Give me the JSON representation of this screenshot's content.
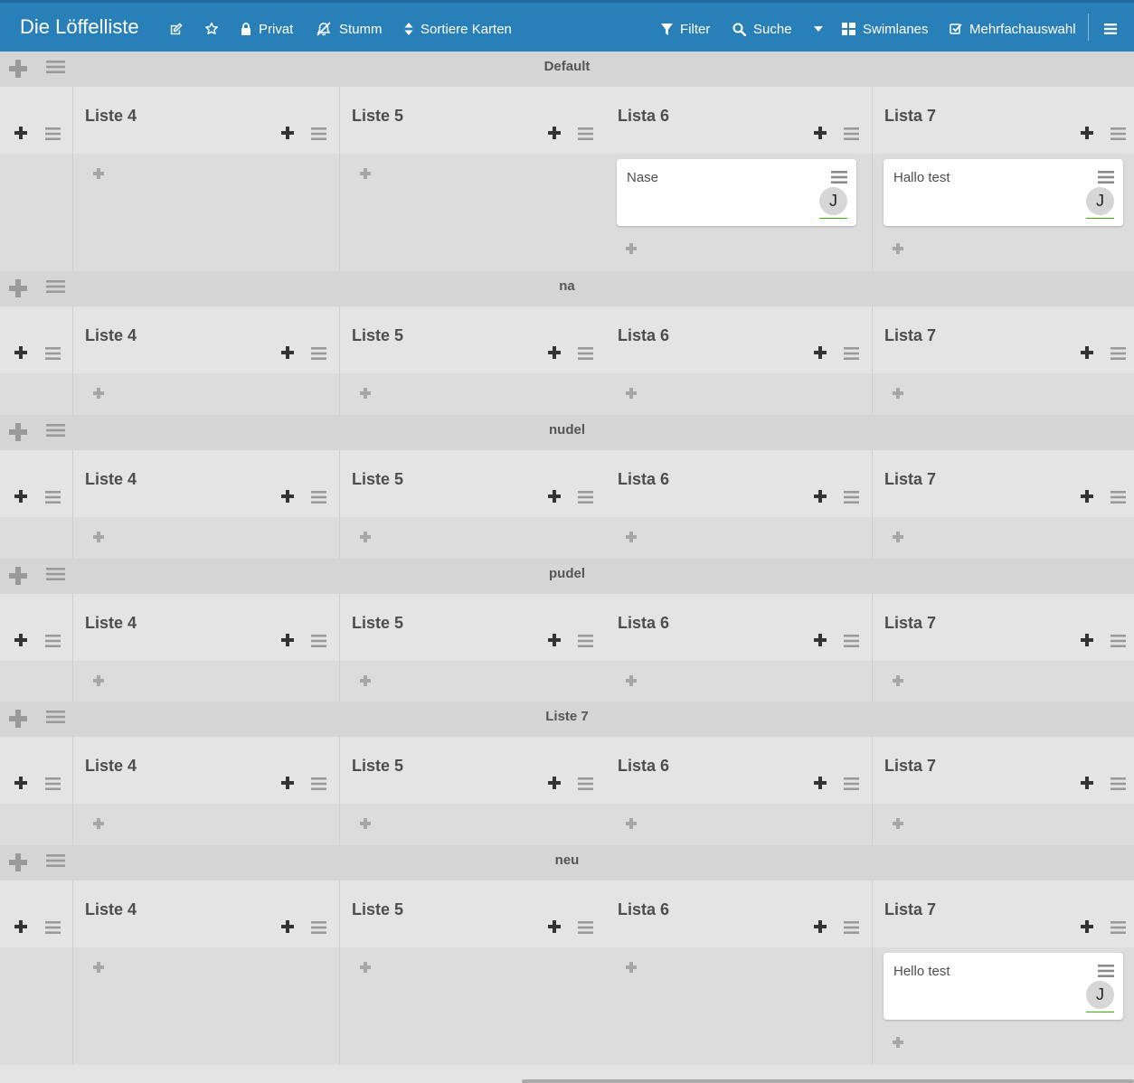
{
  "header": {
    "board_title": "Die Löffelliste",
    "private_label": "Privat",
    "mute_label": "Stumm",
    "sort_label": "Sortiere Karten",
    "filter_label": "Filter",
    "search_label": "Suche",
    "swimlanes_label": "Swimlanes",
    "multiselect_label": "Mehrfachauswahl"
  },
  "lists": [
    "Liste 4",
    "Liste 5",
    "Lista 6",
    "Lista 7"
  ],
  "swimlanes": [
    {
      "title": "Default",
      "cards": [
        {
          "list": 2,
          "title": "Nase",
          "avatar": "J"
        },
        {
          "list": 3,
          "title": "Hallo test",
          "avatar": "J"
        }
      ]
    },
    {
      "title": "na",
      "cards": []
    },
    {
      "title": "nudel",
      "cards": []
    },
    {
      "title": "pudel",
      "cards": []
    },
    {
      "title": "Liste 7",
      "cards": []
    },
    {
      "title": "neu",
      "cards": [
        {
          "list": 3,
          "title": "Hello test",
          "avatar": "J"
        }
      ]
    }
  ],
  "colors": {
    "header_bg": "#2980b9",
    "swimlane_bar": "#d5d5d5",
    "list_bg": "#e4e4e4",
    "card_bg": "#ffffff",
    "member_line": "#3cb500"
  }
}
